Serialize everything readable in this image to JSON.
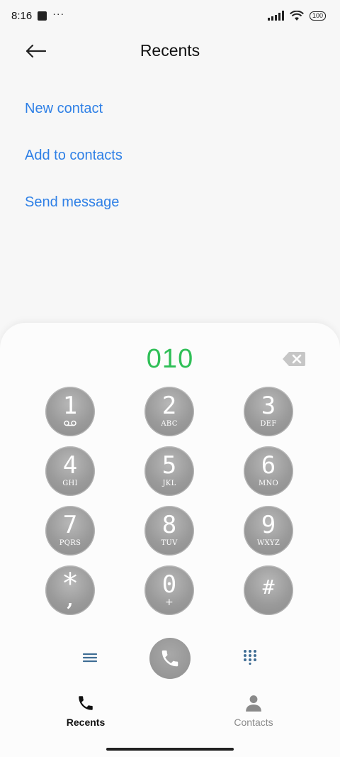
{
  "status_bar": {
    "time": "8:16",
    "dots": "···",
    "battery": "100"
  },
  "header": {
    "title": "Recents"
  },
  "actions": [
    {
      "label": "New contact"
    },
    {
      "label": "Add to contacts"
    },
    {
      "label": "Send message"
    }
  ],
  "dialer": {
    "number": "010",
    "keys": [
      {
        "digit": "1",
        "letters": ""
      },
      {
        "digit": "2",
        "letters": "ABC"
      },
      {
        "digit": "3",
        "letters": "DEF"
      },
      {
        "digit": "4",
        "letters": "GHI"
      },
      {
        "digit": "5",
        "letters": "JKL"
      },
      {
        "digit": "6",
        "letters": "MNO"
      },
      {
        "digit": "7",
        "letters": "PQRS"
      },
      {
        "digit": "8",
        "letters": "TUV"
      },
      {
        "digit": "9",
        "letters": "WXYZ"
      },
      {
        "digit": "*",
        "letters": ","
      },
      {
        "digit": "0",
        "letters": "+"
      },
      {
        "digit": "#",
        "letters": ""
      }
    ]
  },
  "nav": {
    "recents": "Recents",
    "contacts": "Contacts"
  },
  "colors": {
    "accent_link": "#2f80e6",
    "dial_number": "#2fbf57",
    "key_gray": "#9a9a9a"
  }
}
